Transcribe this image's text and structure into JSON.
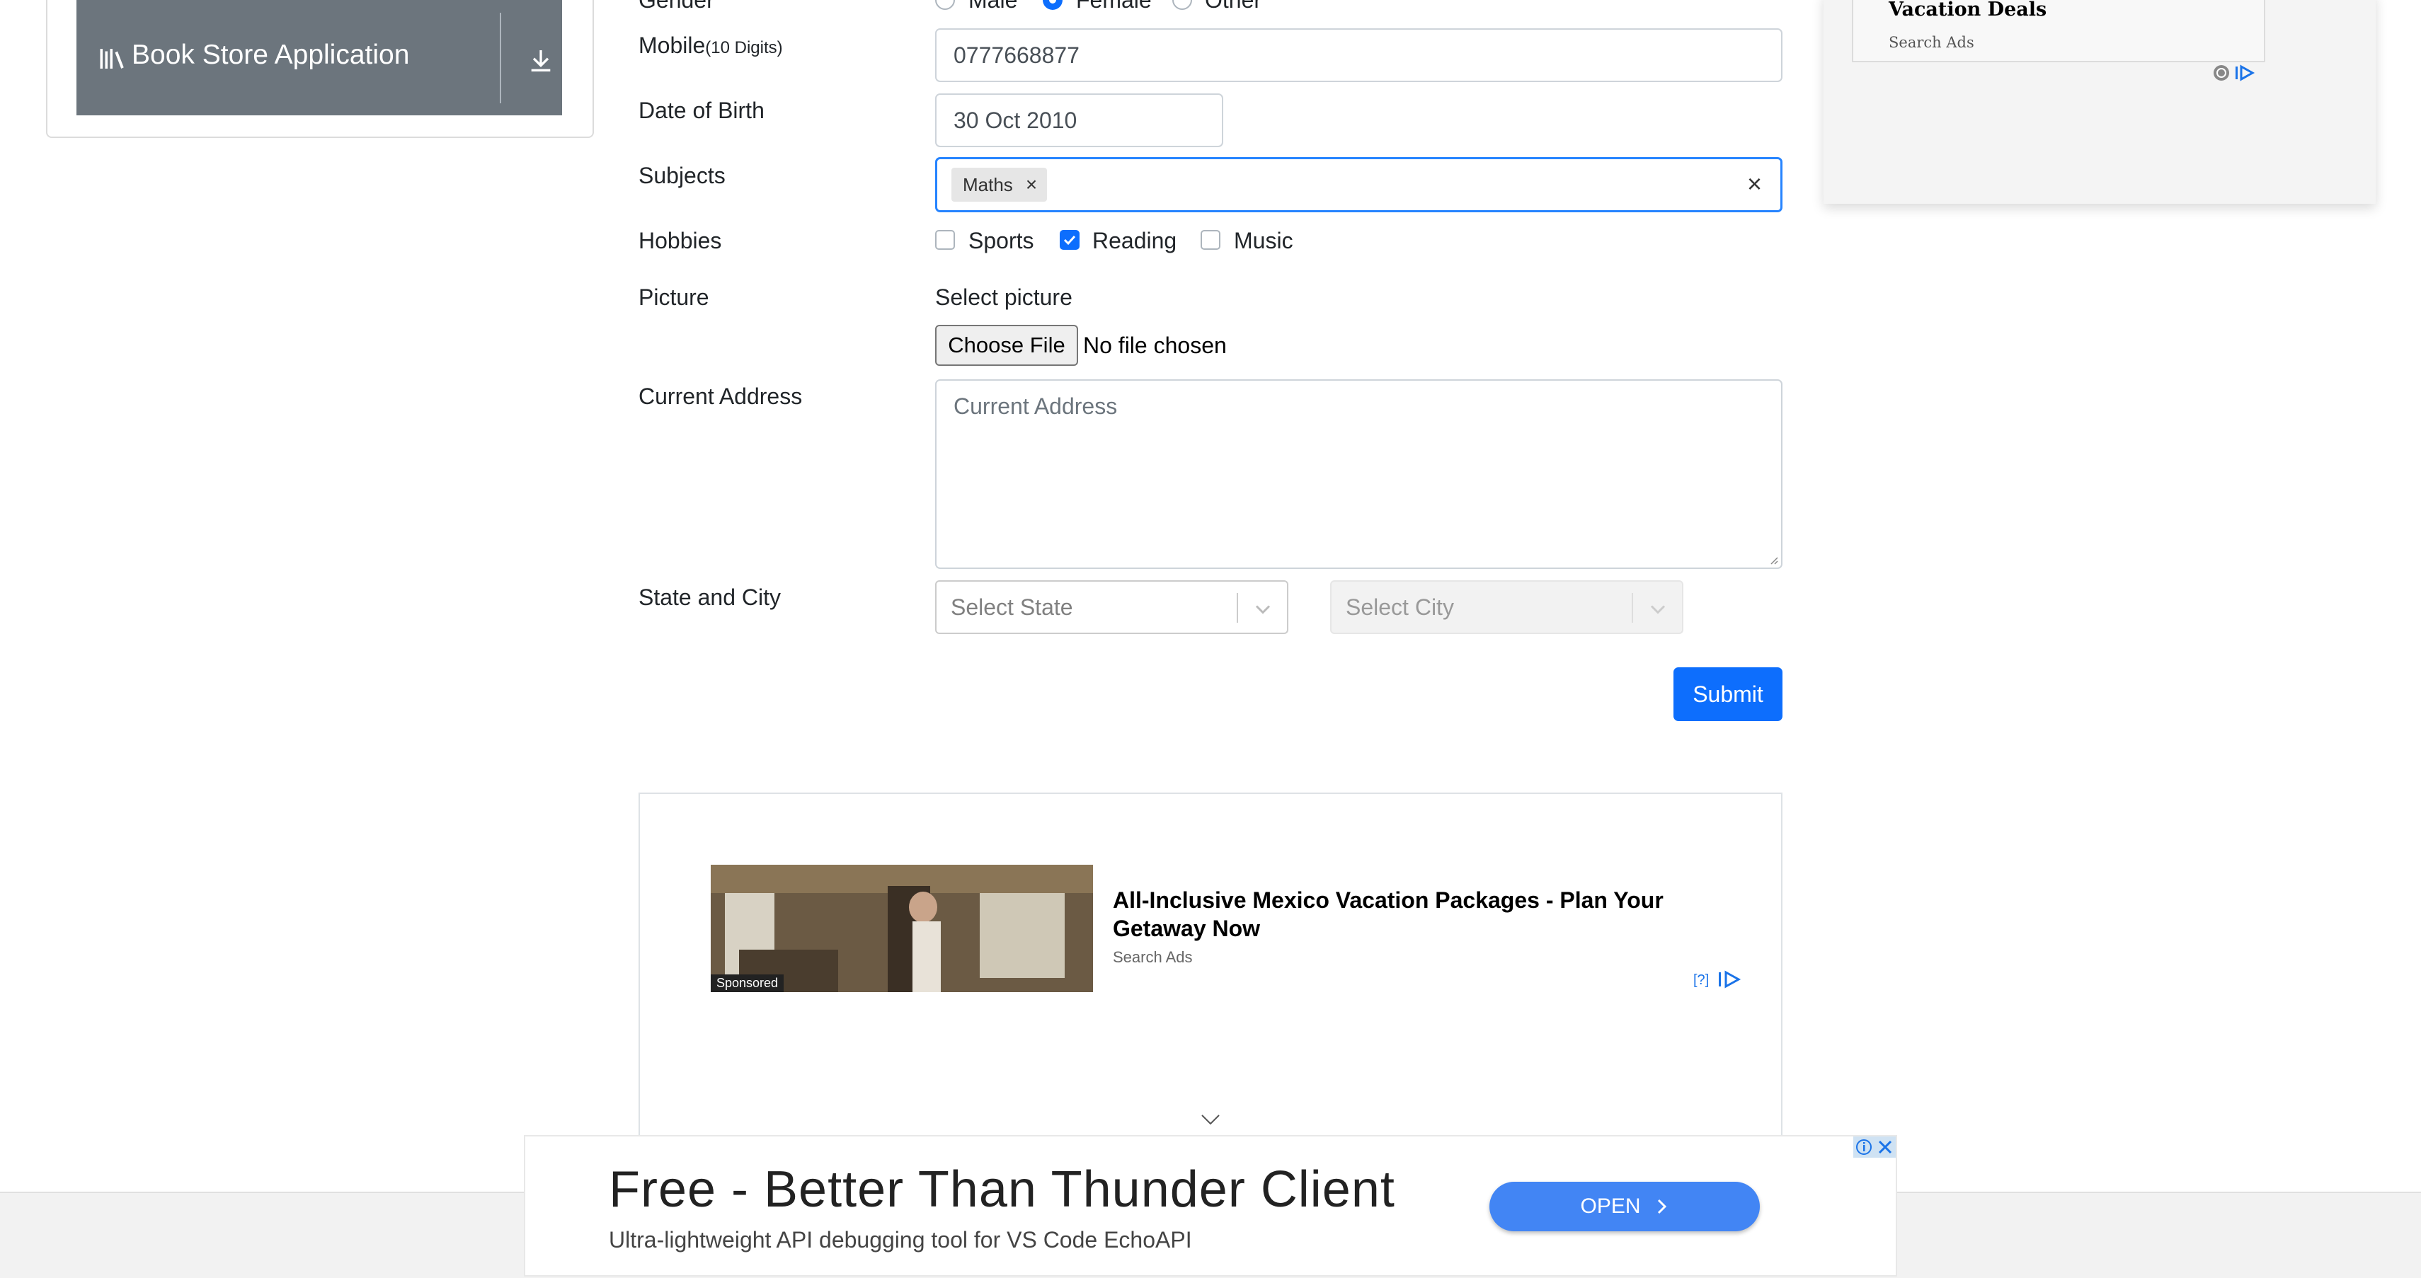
{
  "sidebar": {
    "book_store_label": "Book Store Application"
  },
  "form": {
    "gender": {
      "label": "Gender",
      "options": [
        "Male",
        "Female",
        "Other"
      ],
      "selected": "Female"
    },
    "mobile": {
      "label": "Mobile",
      "hint": "(10 Digits)",
      "value": "0777668877"
    },
    "dob": {
      "label": "Date of Birth",
      "value": "30 Oct 2010"
    },
    "subjects": {
      "label": "Subjects",
      "chips": [
        "Maths"
      ],
      "clear": "×",
      "chip_remove": "×"
    },
    "hobbies": {
      "label": "Hobbies",
      "options": [
        {
          "label": "Sports",
          "checked": false
        },
        {
          "label": "Reading",
          "checked": true
        },
        {
          "label": "Music",
          "checked": false
        }
      ]
    },
    "picture": {
      "label": "Picture",
      "select_text": "Select picture",
      "button": "Choose File",
      "status": "No file chosen"
    },
    "address": {
      "label": "Current Address",
      "placeholder": "Current Address"
    },
    "state_city": {
      "label": "State and City",
      "state_placeholder": "Select State",
      "city_placeholder": "Select City"
    },
    "submit": "Submit"
  },
  "inline_ad": {
    "sponsored": "Sponsored",
    "title": "All-Inclusive Mexico Vacation Packages - Plan Your Getaway Now",
    "source": "Search Ads",
    "help": "[?]"
  },
  "right_ad": {
    "title": "Vacation Deals",
    "source": "Search Ads"
  },
  "banner_ad": {
    "headline": "Free - Better Than Thunder Client",
    "subtext": "Ultra-lightweight API debugging tool for VS Code EchoAPI",
    "cta": "OPEN"
  },
  "colors": {
    "primary": "#0d6efd",
    "sidebar_button": "#6c757d",
    "ad_cta": "#4285f4"
  }
}
